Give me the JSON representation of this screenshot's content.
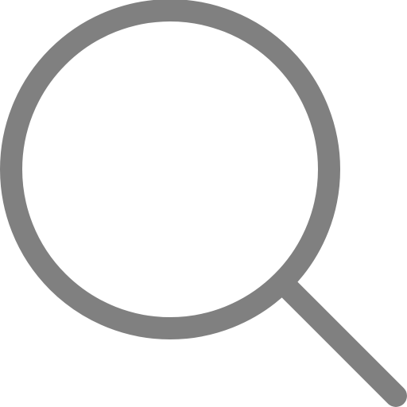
{
  "icon": {
    "name": "search-icon",
    "stroke_color": "#808080",
    "background_color": "#ffffff"
  }
}
